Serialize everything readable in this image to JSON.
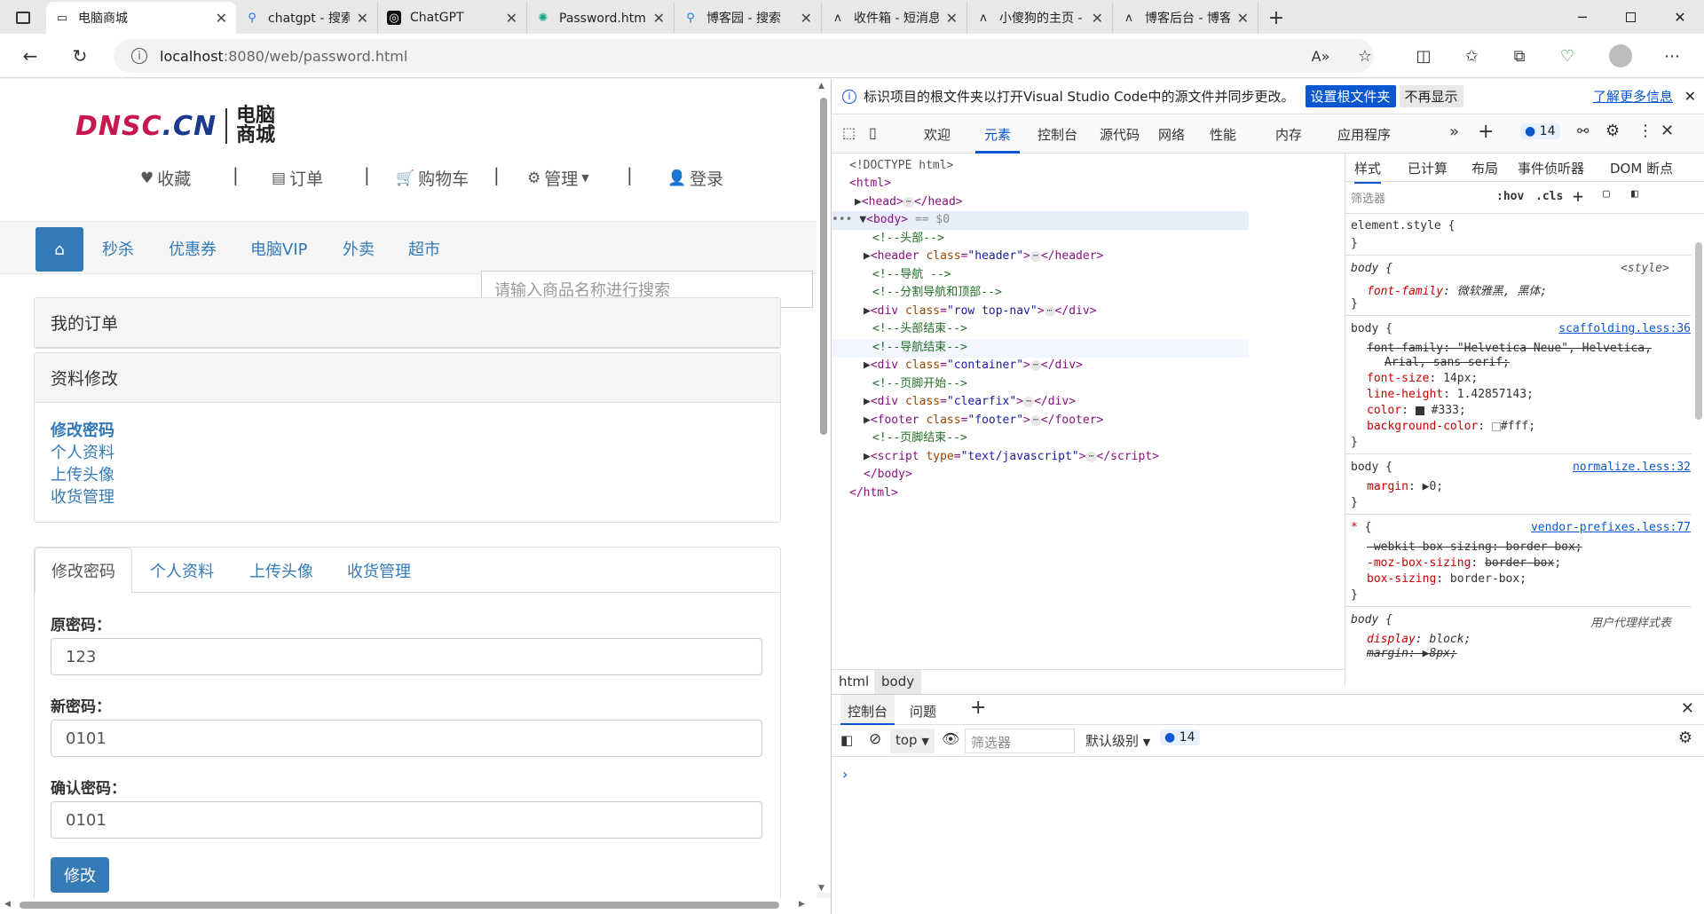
{
  "browser": {
    "tabs": [
      {
        "title": "电脑商城",
        "icon": "page-icon",
        "active": true
      },
      {
        "title": "chatgpt - 搜索",
        "icon": "search-icon",
        "active": false
      },
      {
        "title": "ChatGPT",
        "icon": "chatgpt-icon",
        "active": false
      },
      {
        "title": "Password.html代码",
        "icon": "openai-icon",
        "active": false
      },
      {
        "title": "博客园 - 搜索",
        "icon": "search-icon",
        "active": false
      },
      {
        "title": "收件箱 - 短消息",
        "icon": "cnblogs-icon",
        "active": false
      },
      {
        "title": "小傻狗的主页 - 博",
        "icon": "cnblogs-icon",
        "active": false
      },
      {
        "title": "博客后台 - 博客园",
        "icon": "cnblogs-icon",
        "active": false
      }
    ],
    "url_host": "localhost",
    "url_path": ":8080/web/password.html"
  },
  "page": {
    "logo_text": "DNSC",
    "logo_dot": ".CN",
    "logo_side_1": "电脑",
    "logo_side_2": "商城",
    "topnav": [
      "收藏",
      "订单",
      "购物车",
      "管理",
      "登录"
    ],
    "topnav_sep": "|",
    "navlinks": [
      "秒杀",
      "优惠券",
      "电脑VIP",
      "外卖",
      "超市"
    ],
    "search_placeholder": "请输入商品名称进行搜索",
    "panel_orders": "我的订单",
    "panel_profile": "资料修改",
    "side_links": [
      "修改密码",
      "个人资料",
      "上传头像",
      "收货管理"
    ],
    "tabs": [
      "修改密码",
      "个人资料",
      "上传头像",
      "收货管理"
    ],
    "form": {
      "old_label": "原密码：",
      "old_value": "123",
      "new_label": "新密码：",
      "new_value": "0101",
      "confirm_label": "确认密码：",
      "confirm_value": "0101",
      "submit": "修改"
    }
  },
  "devtools": {
    "info": "标识项目的根文件夹以打开Visual Studio Code中的源文件并同步更改。",
    "info_btn1": "设置根文件夹",
    "info_btn2": "不再显示",
    "info_link": "了解更多信息",
    "tabs": [
      "欢迎",
      "元素",
      "控制台",
      "源代码",
      "网络",
      "性能",
      "内存",
      "应用程序"
    ],
    "issues_count": "14",
    "styles_tabs": [
      "样式",
      "已计算",
      "布局",
      "事件侦听器",
      "DOM 断点"
    ],
    "filter_placeholder": "筛选器",
    "hov": ":hov",
    "cls": ".cls",
    "crumbs": [
      "html",
      "body"
    ],
    "drawer_tabs": [
      "控制台",
      "问题"
    ],
    "console_context": "top",
    "console_filter": "筛选器",
    "console_level": "默认级别",
    "console_count": "14",
    "dom": {
      "doctype": "<!DOCTYPE html>",
      "html_open": "<html>",
      "head": "head",
      "body": "body",
      "eq0": "== $0",
      "c1": "<!--头部-->",
      "header_class": "header",
      "c2": "<!--导航 -->",
      "c3": "<!--分割导航和顶部-->",
      "div_class1": "row top-nav",
      "c4": "<!--头部结束-->",
      "c5": "<!--导航结束-->",
      "div_class2": "container",
      "c6": "<!--页脚开始-->",
      "div_class3": "clearfix",
      "footer_class": "footer",
      "c7": "<!--页脚结束-->",
      "script_type": "text/javascript",
      "body_close": "</body>",
      "html_close": "</html>"
    },
    "styles": {
      "element_style": "element.style {",
      "style_src": "<style>",
      "ff_val": "微软雅黑, 黑体;",
      "scaffolding": "scaffolding.less:36",
      "ff2": "\"Helvetica Neue\", Helvetica,",
      "ff2b": "Arial, sans-serif;",
      "font_size": "14px;",
      "line_height": "1.42857143;",
      "color": "#333;",
      "bg": "#fff;",
      "normalize": "normalize.less:32",
      "margin": "0;",
      "vendor": "vendor-prefixes.less:77",
      "ua": "用户代理样式表",
      "display": "block;",
      "margin8": "8px;"
    }
  },
  "colors": {
    "accent": "#337ab7",
    "edge_blue": "#0b57d0"
  }
}
